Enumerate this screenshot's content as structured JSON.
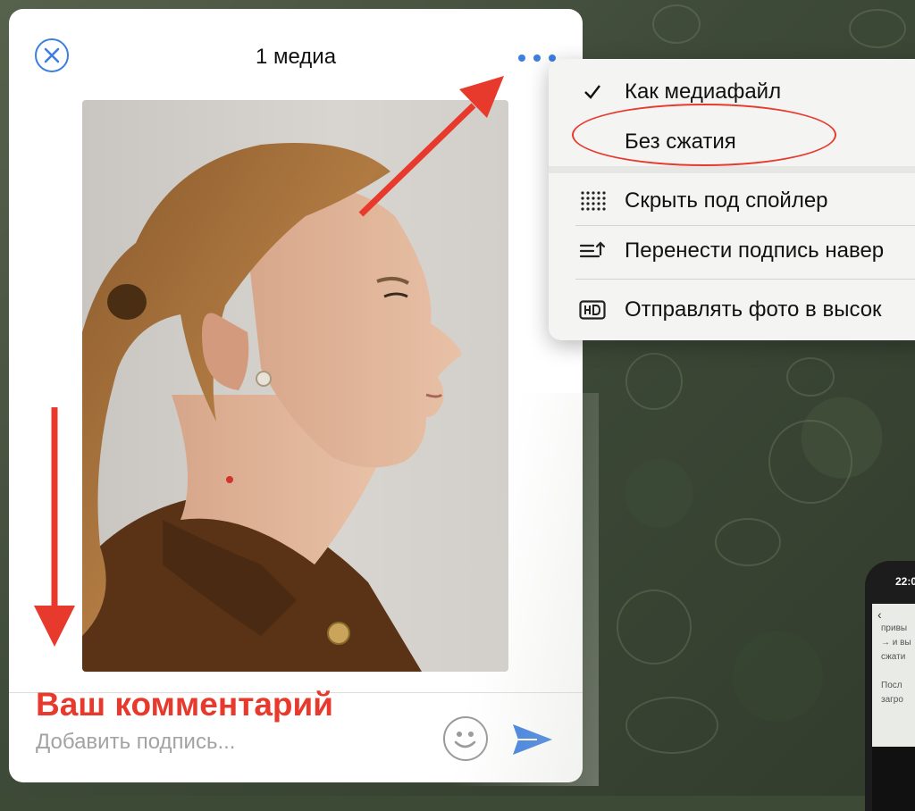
{
  "dialog": {
    "title": "1 медиа",
    "comment_label": "Ваш комментарий",
    "caption_placeholder": "Добавить подпись..."
  },
  "menu": {
    "items": [
      {
        "label": "Как медиафайл",
        "icon": "checkmark-icon",
        "selected": true
      },
      {
        "label": "Без сжатия",
        "icon": "",
        "highlighted": true
      },
      {
        "label": "Скрыть под спойлер",
        "icon": "spoiler-dots-icon"
      },
      {
        "label": "Перенести подпись навер",
        "icon": "move-caption-up-icon"
      },
      {
        "label": "Отправлять фото в высок",
        "icon": "hd-icon"
      }
    ]
  },
  "phone": {
    "time": "22:0",
    "lines": [
      "привы",
      "→ и вы",
      "сжати",
      "Посл",
      "загро"
    ]
  },
  "colors": {
    "accent": "#3d7ee0",
    "annotation_red": "#e8392d",
    "background_green": "#3d4a36"
  }
}
